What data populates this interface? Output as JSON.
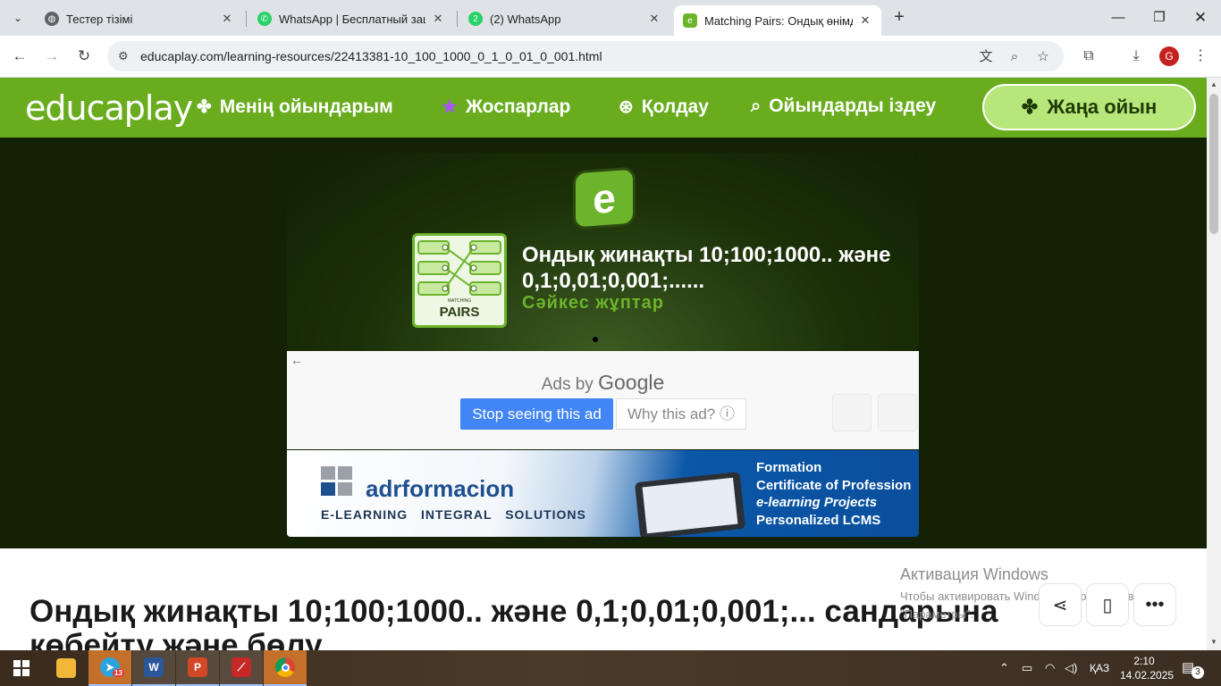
{
  "browser": {
    "tabs": [
      {
        "title": "Тестер тізімі",
        "favicon": "globe-icon",
        "active": false
      },
      {
        "title": "WhatsApp | Бесплатный защищ",
        "favicon": "whatsapp-icon",
        "active": false
      },
      {
        "title": "(2) WhatsApp",
        "favicon": "whatsapp-badge-icon",
        "badge": "2",
        "active": false
      },
      {
        "title": "Matching Pairs: Ондық өнімді",
        "favicon": "educaplay-icon",
        "active": true
      }
    ],
    "url": "educaplay.com/learning-resources/22413381-10_100_1000_0_1_0_01_0_001.html",
    "profile_initial": "G"
  },
  "site": {
    "logo": "educaplay",
    "nav": {
      "my_games": "Менің ойындарым",
      "plans": "Жоспарлар",
      "support": "Қолдау",
      "search_games": "Ойындарды іздеу",
      "new_game": "Жаңа ойын"
    },
    "colors": {
      "brand_green": "#69ad1f",
      "accent_green": "#6cb42b",
      "ad_blue": "#4285f4"
    }
  },
  "game_card": {
    "badge_letter": "e",
    "icon_label_small": "MATCHING",
    "icon_label": "PAIRS",
    "title": "Ондық жинақты 10;100;1000.. және 0,1;0,01;0,001;......",
    "subtitle": "Сәйкес жұптар"
  },
  "ad": {
    "ads_by": "Ads by",
    "google": "Google",
    "stop_button": "Stop seeing this ad",
    "why_button": "Why this ad? ⓘ",
    "banner": {
      "brand": "adrformacion",
      "tagline": "E-LEARNING INTEGRAL SOLUTIONS",
      "lines": [
        "Formation",
        "Certificate of Profession",
        "e-learning Projects",
        "Personalized LCMS"
      ]
    }
  },
  "page": {
    "title": "Ондық жинақты 10;100;1000.. және 0,1;0,01;0,001;... сандарына көбейту және бөлу",
    "watermark_title": "Активация Windows",
    "watermark_text": "Чтобы активировать Windows, перейдите в раздел \"Параметры\"."
  },
  "taskbar": {
    "telegram_badge": "13",
    "language": "ҚАЗ",
    "time": "2:10",
    "date": "14.02.2025",
    "notifications": "3"
  }
}
